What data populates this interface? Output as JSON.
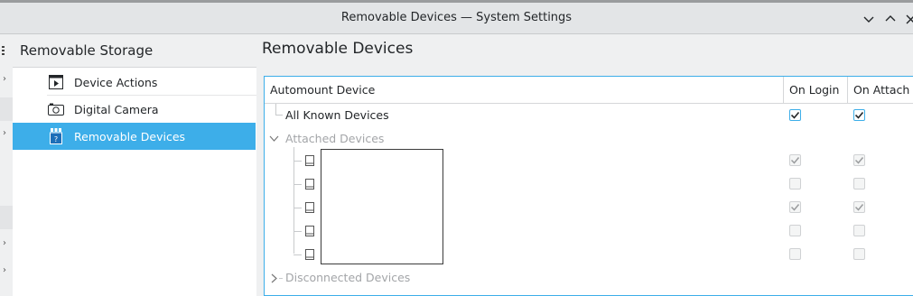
{
  "window": {
    "title": "Removable Devices — System Settings",
    "controls": [
      "minimize",
      "maximize",
      "close"
    ]
  },
  "sidebar": {
    "header": "Removable Storage",
    "items": [
      {
        "label": "Device Actions",
        "icon": "device-actions-icon",
        "selected": false
      },
      {
        "label": "Digital Camera",
        "icon": "camera-icon",
        "selected": false
      },
      {
        "label": "Removable Devices",
        "icon": "removable-device-icon",
        "selected": true
      }
    ]
  },
  "main": {
    "heading": "Removable Devices",
    "table": {
      "columns": [
        "Automount Device",
        "On Login",
        "On Attach"
      ],
      "all_known": {
        "label": "All Known Devices",
        "on_login": true,
        "on_attach": true
      },
      "attached": {
        "label": "Attached Devices",
        "expanded": true,
        "devices": [
          {
            "on_login": true,
            "on_attach": true
          },
          {
            "on_login": false,
            "on_attach": false
          },
          {
            "on_login": true,
            "on_attach": true
          },
          {
            "on_login": false,
            "on_attach": false
          },
          {
            "on_login": false,
            "on_attach": false
          }
        ]
      },
      "disconnected": {
        "label": "Disconnected Devices",
        "expanded": false
      }
    }
  },
  "colors": {
    "accent": "#3daee9",
    "disabled_text": "#a3a5a8"
  }
}
